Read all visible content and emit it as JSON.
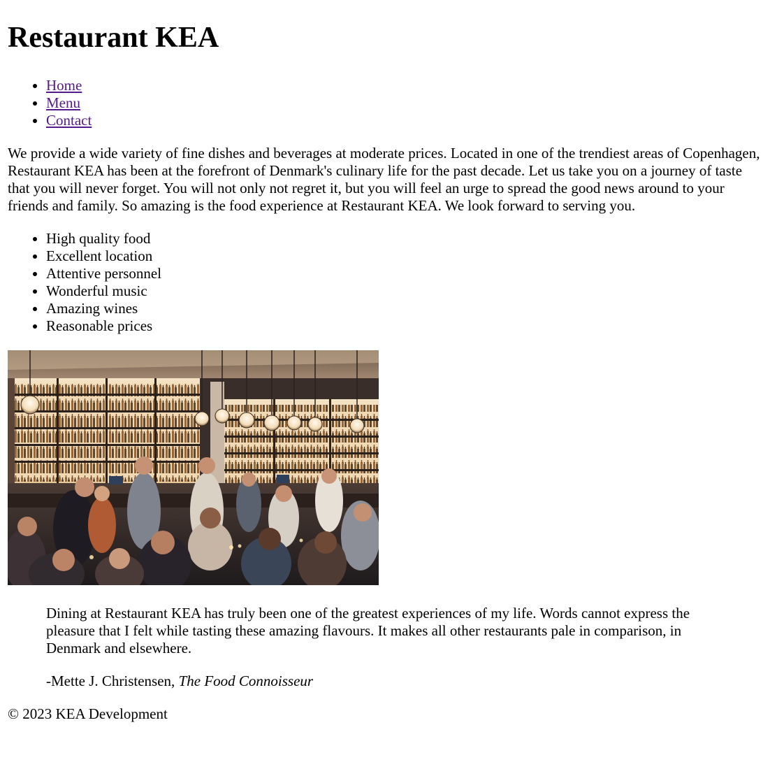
{
  "page": {
    "title": "Restaurant KEA"
  },
  "nav": {
    "items": [
      {
        "label": "Home"
      },
      {
        "label": "Menu"
      },
      {
        "label": "Contact"
      }
    ],
    "link_color": "#551a8b"
  },
  "intro": {
    "text": "We provide a wide variety of fine dishes and beverages at moderate prices. Located in one of the trendiest areas of Copenhagen, Restaurant KEA has been at the forefront of Denmark's culinary life for the past decade. Let us take you on a journey of taste that you will never forget. You will not only not regret it, but you will feel an urge to spread the good news around to your friends and family. So amazing is the food experience at Restaurant KEA. We look forward to serving you."
  },
  "features": {
    "items": [
      "High quality food",
      "Excellent location",
      "Attentive personnel",
      "Wonderful music",
      "Amazing wines",
      "Reasonable prices"
    ]
  },
  "testimonial": {
    "quote": "Dining at Restaurant KEA has truly been one of the greatest experiences of my life. Words cannot express the pleasure that I felt while tasting these amazing flavours. It makes all other restaurants pale in comparison, in Denmark and elsewhere.",
    "author_prefix": "-Mette J. Christensen, ",
    "source": "The Food Connoisseur"
  },
  "footer": {
    "text": "© 2023 KEA Development"
  }
}
